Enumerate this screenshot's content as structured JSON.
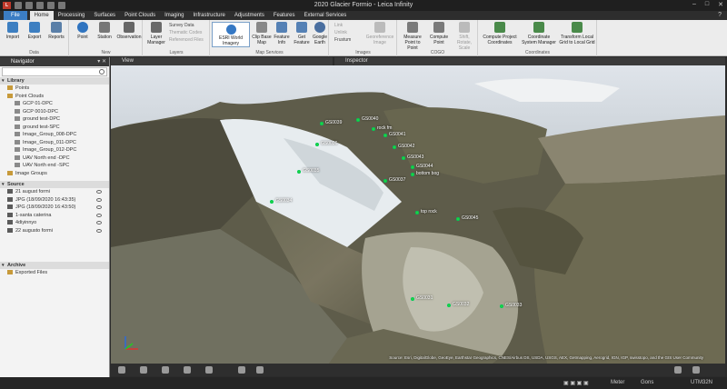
{
  "window": {
    "title": "2020 Glacier Formio - Leica Infinity",
    "app_icon": "L"
  },
  "menu": {
    "tabs": [
      "File",
      "Home",
      "Processing",
      "Surfaces",
      "Point Clouds",
      "Imaging",
      "Infrastructure",
      "Adjustments",
      "Features",
      "External Services"
    ],
    "active": "Home"
  },
  "ribbon": {
    "data": {
      "label": "Data",
      "import": "Import",
      "export": "Export",
      "reports": "Reports"
    },
    "new": {
      "label": "New",
      "point": "Point",
      "station": "Station",
      "observation": "Observation"
    },
    "layers": {
      "label": "Layers",
      "layer_manager": "Layer Manager",
      "survey_data": "Survey Data",
      "thematic_codes": "Thematic Codes",
      "referenced_files": "Referenced Files"
    },
    "map_services": {
      "label": "Map Services",
      "esri": "ESRI World Imagery",
      "clip_base_map": "Clip Base Map",
      "feature_info": "Feature Info",
      "get_feature": "Get Feature",
      "google_earth": "Google Earth"
    },
    "images": {
      "label": "Images",
      "link": "Link",
      "unlink": "Unlink",
      "frustum": "Frustum",
      "georeference": "Georeference Image"
    },
    "cogo": {
      "label": "COGO",
      "measure": "Measure Point to Point",
      "compute_point": "Compute Point",
      "shift": "Shift, Rotate, Scale"
    },
    "coordinates": {
      "label": "Coordinates",
      "compute": "Compute Project Coordinates",
      "coord_system": "Coordinate System Manager",
      "transform": "Transform Local Grid to Local Grid"
    }
  },
  "navigator": {
    "title": "Navigator",
    "library": {
      "title": "Library",
      "items": [
        {
          "label": "Points",
          "indent": 0
        },
        {
          "label": "Point Clouds",
          "indent": 0
        },
        {
          "label": "GCP 01-DPC",
          "indent": 1
        },
        {
          "label": "GCP 0010-DPC",
          "indent": 1
        },
        {
          "label": "ground test-DPC",
          "indent": 1
        },
        {
          "label": "ground test-SPC",
          "indent": 1
        },
        {
          "label": "Image_Group_008-DPC",
          "indent": 1
        },
        {
          "label": "Image_Group_011-DPC",
          "indent": 1
        },
        {
          "label": "Image_Group_012-DPC",
          "indent": 1
        },
        {
          "label": "UAV North end -DPC",
          "indent": 1
        },
        {
          "label": "UAV North end -SPC",
          "indent": 1
        },
        {
          "label": "Image Groups",
          "indent": 0
        }
      ]
    },
    "source": {
      "title": "Source",
      "items": [
        "21 august formi",
        "JPG (18/09/2020 16:43:35)",
        "JPG (18/09/2020 16:43:50)",
        "1-santa caterina",
        "4diyinnyo",
        "22 augusto formi"
      ]
    },
    "archive": {
      "title": "Archive",
      "items": [
        "Exported Files"
      ]
    }
  },
  "views": {
    "view_tab": "View",
    "inspector_tab": "Inspector"
  },
  "markers": [
    "GS0039",
    "GS0040",
    "rock fm",
    "GS0041",
    "GS0042",
    "GS0043",
    "GS0044",
    "bottom bog",
    "GS0037",
    "GS0036",
    "GS0035",
    "GS0034",
    "top rock",
    "GS0045",
    "GS0031",
    "GS0032",
    "GS0033"
  ],
  "attribution": "Source: Esri, DigitalGlobe, GeoEye, Earthstar Geographics, CNES/Airbus DS, USDA, USGS, AEX, Getmapping, Aerogrid, IGN, IGP, swisstopo, and the GIS User Community",
  "status": {
    "units": "Meter",
    "angle": "Gons",
    "crs": "UTM32N"
  }
}
